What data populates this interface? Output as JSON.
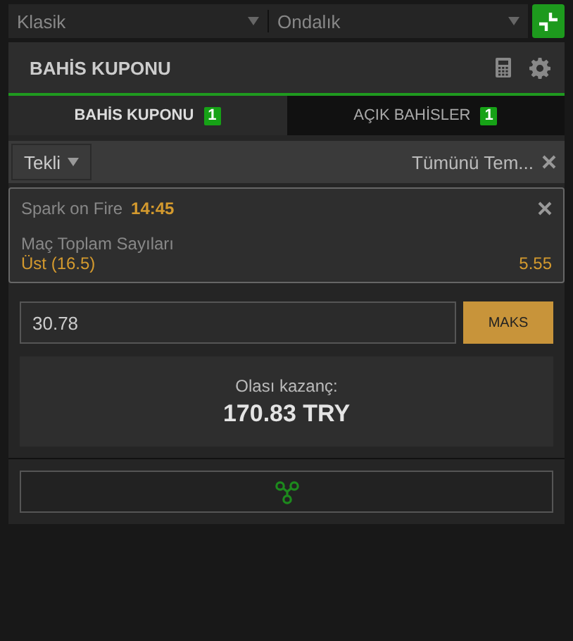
{
  "selects": [
    {
      "value": "Klasik"
    },
    {
      "value": "Ondalık"
    }
  ],
  "header": {
    "title": "BAHİS KUPONU"
  },
  "tabs": [
    {
      "label": "BAHİS KUPONU",
      "count": "1",
      "selected": true
    },
    {
      "label": "AÇIK BAHİSLER",
      "count": "1",
      "selected": false
    }
  ],
  "toolbar": {
    "bet_type": "Tekli",
    "clear_all": "Tümünü Tem..."
  },
  "bet": {
    "event": "Spark on Fire",
    "time": "14:45",
    "market": "Maç Toplam Sayıları",
    "selection": "Üst (16.5)",
    "odds": "5.55"
  },
  "stake": {
    "value": "30.78",
    "max_button": "MAKS"
  },
  "winnings": {
    "label": "Olası kazanç:",
    "amount": "170.83 TRY"
  }
}
